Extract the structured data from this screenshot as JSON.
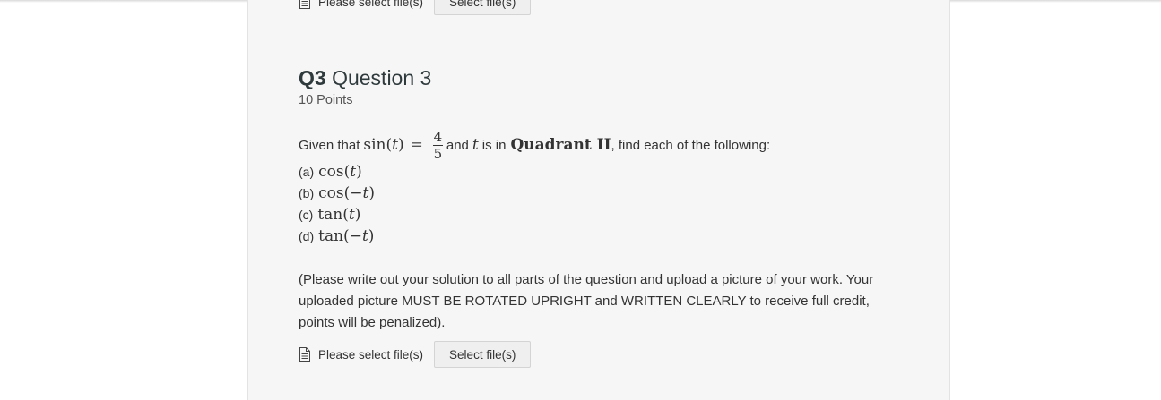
{
  "upload_top": {
    "label": "Please select file(s)",
    "button": "Select file(s)"
  },
  "question": {
    "number": "Q3",
    "title": "Question 3",
    "points": "10 Points",
    "given_prefix": "Given that",
    "given_func": "sin",
    "given_var": "t",
    "equals": "=",
    "frac_num": "4",
    "frac_den": "5",
    "and_text": "and",
    "in_text": "is in",
    "quadrant": "Quadrant II",
    "suffix": ", find each of the following:",
    "parts": [
      {
        "label": "(a)",
        "func": "cos",
        "arg": "t",
        "neg": ""
      },
      {
        "label": "(b)",
        "func": "cos",
        "arg": "t",
        "neg": "−"
      },
      {
        "label": "(c)",
        "func": "tan",
        "arg": "t",
        "neg": ""
      },
      {
        "label": "(d)",
        "func": "tan",
        "arg": "t",
        "neg": "−"
      }
    ],
    "instructions": "(Please write out your solution to all parts of the question and upload a picture of your work. Your uploaded picture MUST BE ROTATED UPRIGHT and WRITTEN CLEARLY to receive full credit, points will be penalized)."
  },
  "upload_bottom": {
    "label": "Please select file(s)",
    "button": "Select file(s)"
  },
  "icons": {
    "file": "file-icon"
  }
}
